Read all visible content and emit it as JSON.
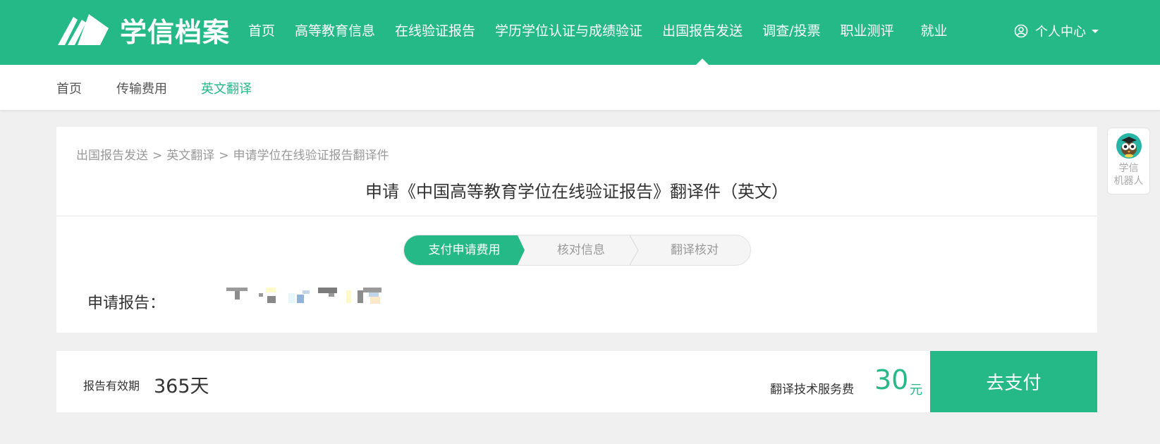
{
  "header": {
    "logo_text": "学信档案",
    "nav": [
      {
        "label": "首页"
      },
      {
        "label": "高等教育信息"
      },
      {
        "label": "在线验证报告"
      },
      {
        "label": "学历学位认证与成绩验证"
      },
      {
        "label": "出国报告发送",
        "active": true
      },
      {
        "label": "调查/投票"
      },
      {
        "label": "职业测评"
      },
      {
        "label": "就业"
      }
    ],
    "user_label": "个人中心"
  },
  "subnav": {
    "items": [
      {
        "label": "首页"
      },
      {
        "label": "传输费用"
      },
      {
        "label": "英文翻译",
        "current": true
      }
    ]
  },
  "breadcrumb": {
    "items": [
      "出国报告发送",
      "英文翻译",
      "申请学位在线验证报告翻译件"
    ],
    "separator": ">"
  },
  "page_title": "申请《中国高等教育学位在线验证报告》翻译件（英文）",
  "steps": [
    {
      "label": "支付申请费用",
      "active": true
    },
    {
      "label": "核对信息"
    },
    {
      "label": "翻译核对"
    }
  ],
  "report": {
    "label": "申请报告："
  },
  "robot": {
    "line1": "学信",
    "line2": "机器人"
  },
  "paybar": {
    "validity_label": "报告有效期",
    "validity_value": "365天",
    "fee_label": "翻译技术服务费",
    "fee_value": "30",
    "fee_unit": "元",
    "pay_button": "去支付"
  },
  "colors": {
    "brand": "#25b987",
    "background": "#f0f0f0"
  }
}
